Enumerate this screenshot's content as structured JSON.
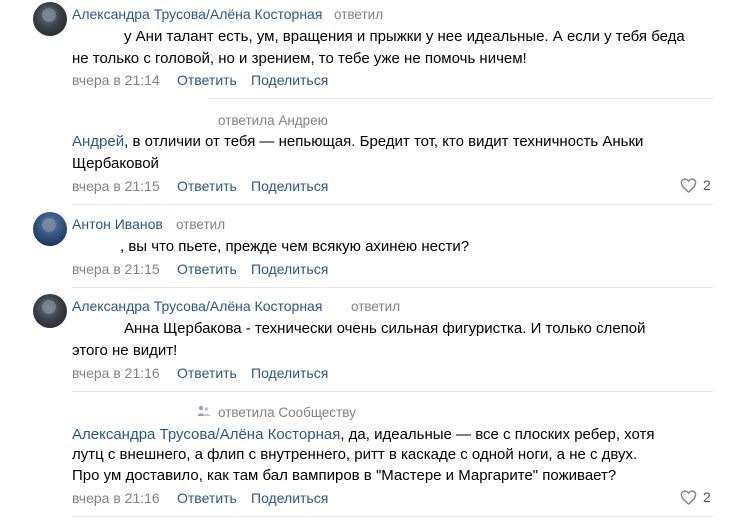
{
  "comments": [
    {
      "author": "Александра Трусова/Алёна Косторная",
      "verb": "ответил",
      "lines": [
        "у Ани талант есть, ум, вращения и прыжки у нее идеальные. А если у тебя беда",
        "не только с головой, но и зрением, то тебе уже не помочь ничем!"
      ],
      "time": "вчера в 21:14",
      "reply": "Ответить",
      "share": "Поделиться"
    },
    {
      "verb": "ответила Андрею",
      "mention": "Андрей",
      "lines": [
        ", в отличии от тебя — непьющая. Бредит тот, кто видит техничность Аньки",
        "Щербаковой"
      ],
      "time": "вчера в 21:15",
      "reply": "Ответить",
      "share": "Поделиться",
      "likes": "2"
    },
    {
      "author": "Антон Иванов",
      "verb": "ответил",
      "lines": [
        ", вы что пьете, прежде чем всякую ахинею нести?"
      ],
      "time": "вчера в 21:15",
      "reply": "Ответить",
      "share": "Поделиться"
    },
    {
      "author": "Александра Трусова/Алёна Косторная",
      "verb": "ответил",
      "lines": [
        "Анна Щербакова - технически очень сильная фигуристка. И только слепой",
        "этого не видит!"
      ],
      "time": "вчера в 21:16",
      "reply": "Ответить",
      "share": "Поделиться"
    },
    {
      "verb": "ответила Сообществу",
      "mention": "Александра Трусова/Алёна Косторная",
      "lines": [
        ", да, идеальные — все с плоских ребер, хотя",
        "лутц с внешнего, а флип с внутреннего, ритт в каскаде с одной ноги, а не с двух.",
        "Про ум доставило, как там бал вампиров в \"Мастере и Маргарите\" поживает?"
      ],
      "time": "вчера в 21:16",
      "reply": "Ответить",
      "share": "Поделиться",
      "likes": "2"
    }
  ],
  "icons": {
    "heart": "heart-icon",
    "avatar": "avatar-photo"
  },
  "colors": {
    "link": "#2a5885",
    "meta": "#828282",
    "divider": "#e7e8ec"
  }
}
